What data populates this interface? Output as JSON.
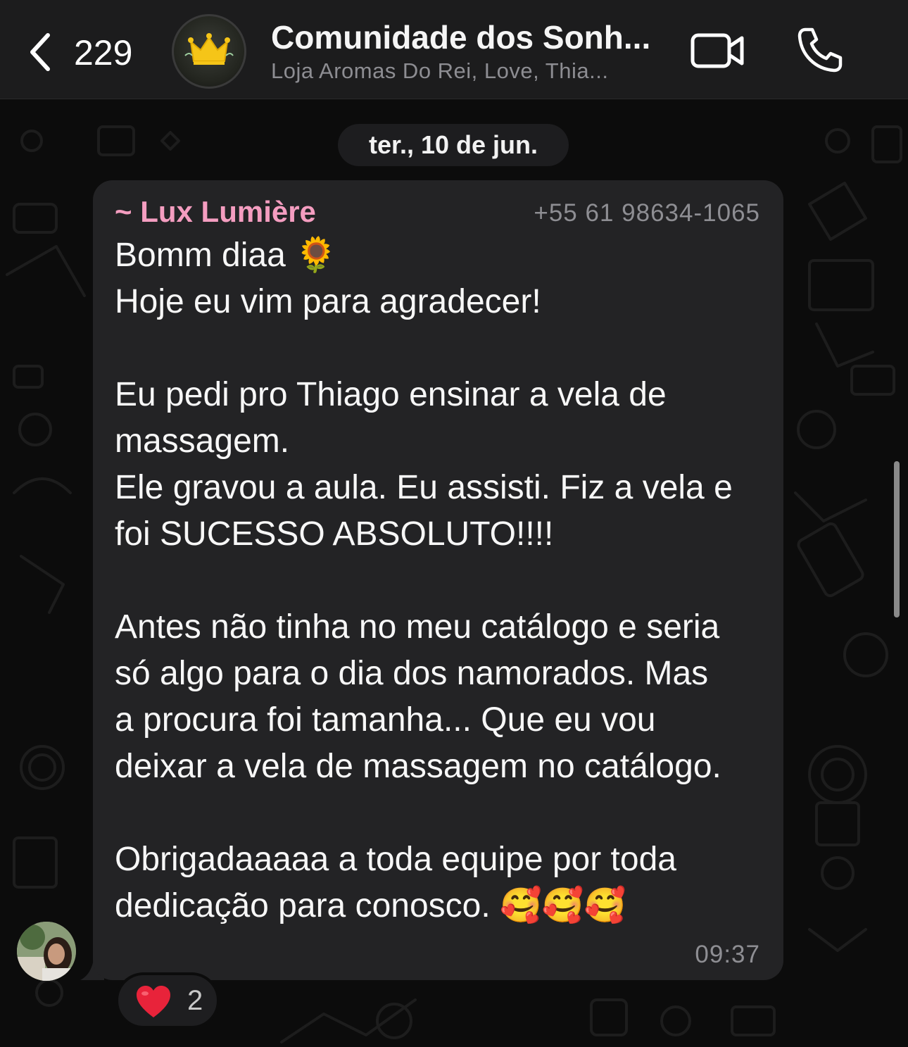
{
  "header": {
    "back_count": "229",
    "title": "Comunidade dos Sonh...",
    "subtitle": "Loja Aromas Do Rei, Love, Thia..."
  },
  "date_chip": "ter., 10 de jun.",
  "message": {
    "sender": "~ Lux Lumière",
    "phone": "+55 61 98634-1065",
    "lines": [
      "Bomm diaa 🌻",
      "Hoje eu vim para agradecer!",
      "",
      "Eu pedi pro Thiago ensinar a vela de",
      "massagem.",
      "Ele gravou a aula. Eu assisti. Fiz a vela e",
      "foi SUCESSO ABSOLUTO!!!!",
      "",
      "Antes não tinha no meu catálogo e seria",
      "só algo para o dia dos namorados. Mas",
      "a procura foi tamanha... Que eu vou",
      "deixar a vela de massagem no catálogo.",
      "",
      "Obrigadaaaaa a toda equipe por toda",
      "dedicação para conosco. 🥰🥰🥰"
    ],
    "time": "09:37",
    "sender_color": "#f49dc0"
  },
  "reaction": {
    "emoji": "heart-icon",
    "count": "2"
  },
  "colors": {
    "background": "#0c0c0c",
    "header": "#1c1c1d",
    "bubble": "#232325",
    "muted_text": "#8e8e93"
  }
}
